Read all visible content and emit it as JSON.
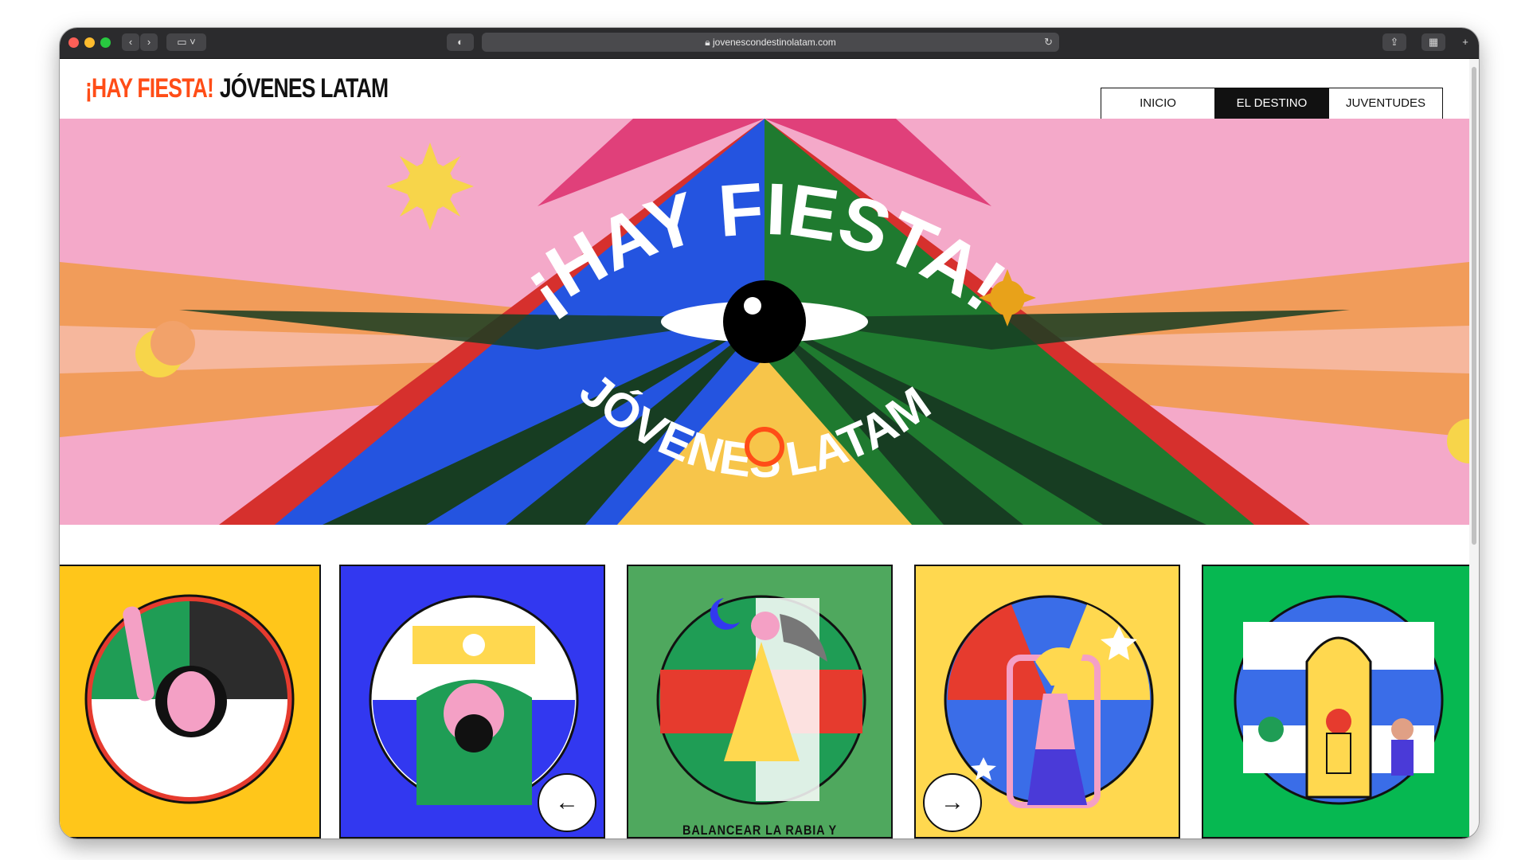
{
  "browser": {
    "url": "jovenescondestinolatam.com",
    "lock_icon": "lock-icon",
    "back_icon": "chevron-left-icon",
    "forward_icon": "chevron-right-icon"
  },
  "site": {
    "logo_part1": "¡HAY FIESTA!",
    "logo_part2": "JÓVENES LATAM",
    "nav": [
      "INICIO",
      "EL DESTINO",
      "JUVENTUDES"
    ],
    "active_nav": "EL DESTINO"
  },
  "hero": {
    "title": "¡HAY FIESTA!",
    "subtitle_left": "JÓVENES",
    "subtitle_right": "LATAM"
  },
  "cards": [
    {
      "bg": "#ffc61a",
      "caption": ""
    },
    {
      "bg": "#3238f0",
      "caption": ""
    },
    {
      "bg": "#4fa85e",
      "caption": "BALANCEAR LA RABIA Y"
    },
    {
      "bg": "#ffd84f",
      "caption": ""
    },
    {
      "bg": "#06b851",
      "caption": ""
    }
  ],
  "carousel": {
    "prev_icon": "arrow-left-icon",
    "next_icon": "arrow-right-icon"
  },
  "colors": {
    "accent": "#ff4d17",
    "pink": "#f4a9c9",
    "orange": "#f19c5a",
    "blue": "#2454e0",
    "green": "#1f7a2f",
    "yellow": "#ffc61a"
  }
}
